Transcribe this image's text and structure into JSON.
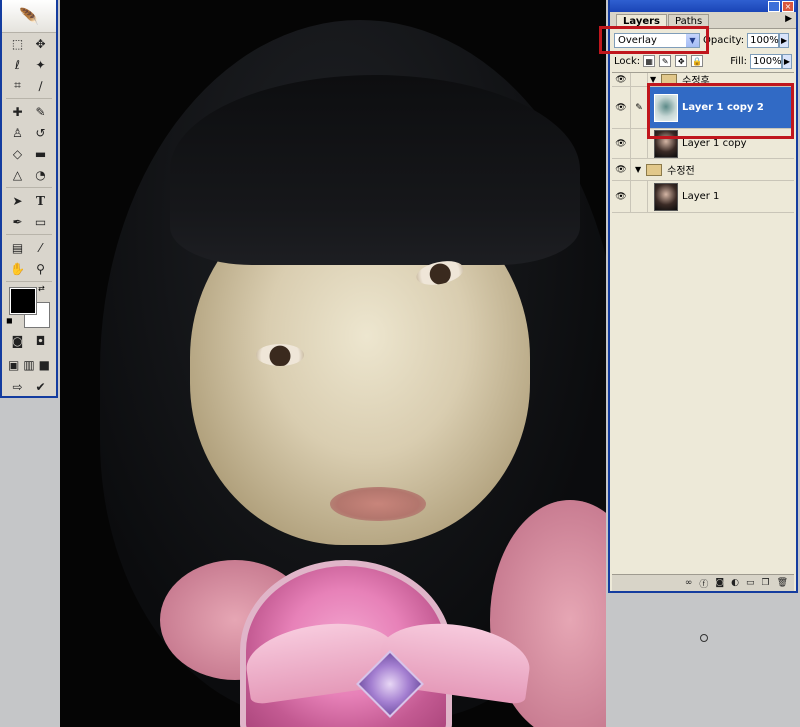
{
  "layers_panel": {
    "tabs": [
      {
        "label": "Layers"
      },
      {
        "label": "Paths"
      }
    ],
    "blend_mode": "Overlay",
    "opacity_label": "Opacity:",
    "opacity_value": "100%",
    "fill_label": "Fill:",
    "fill_value": "100%",
    "lock_label": "Lock:",
    "groups": [
      {
        "name": "수정후"
      },
      {
        "name": "수정전"
      }
    ],
    "layers": [
      {
        "name": "Layer 1 copy 2",
        "selected": true
      },
      {
        "name": "Layer 1 copy",
        "selected": false
      },
      {
        "name": "Layer 1",
        "selected": false
      }
    ],
    "bottom_icons": [
      "link-icon",
      "fx-icon",
      "mask-icon",
      "adjustment-icon",
      "folder-icon",
      "new-layer-icon",
      "trash-icon"
    ]
  },
  "toolbox": {
    "tools": [
      "marquee-icon",
      "move-icon",
      "lasso-icon",
      "magic-wand-icon",
      "crop-icon",
      "slice-icon",
      "healing-icon",
      "brush-icon",
      "stamp-icon",
      "history-brush-icon",
      "eraser-icon",
      "gradient-icon",
      "blur-icon",
      "dodge-icon",
      "path-select-icon",
      "type-icon",
      "pen-icon",
      "shape-icon",
      "notes-icon",
      "eyedropper-icon",
      "hand-icon",
      "zoom-icon"
    ],
    "foreground_color": "#000000",
    "background_color": "#ffffff"
  },
  "highlight_color": "#c0161d"
}
